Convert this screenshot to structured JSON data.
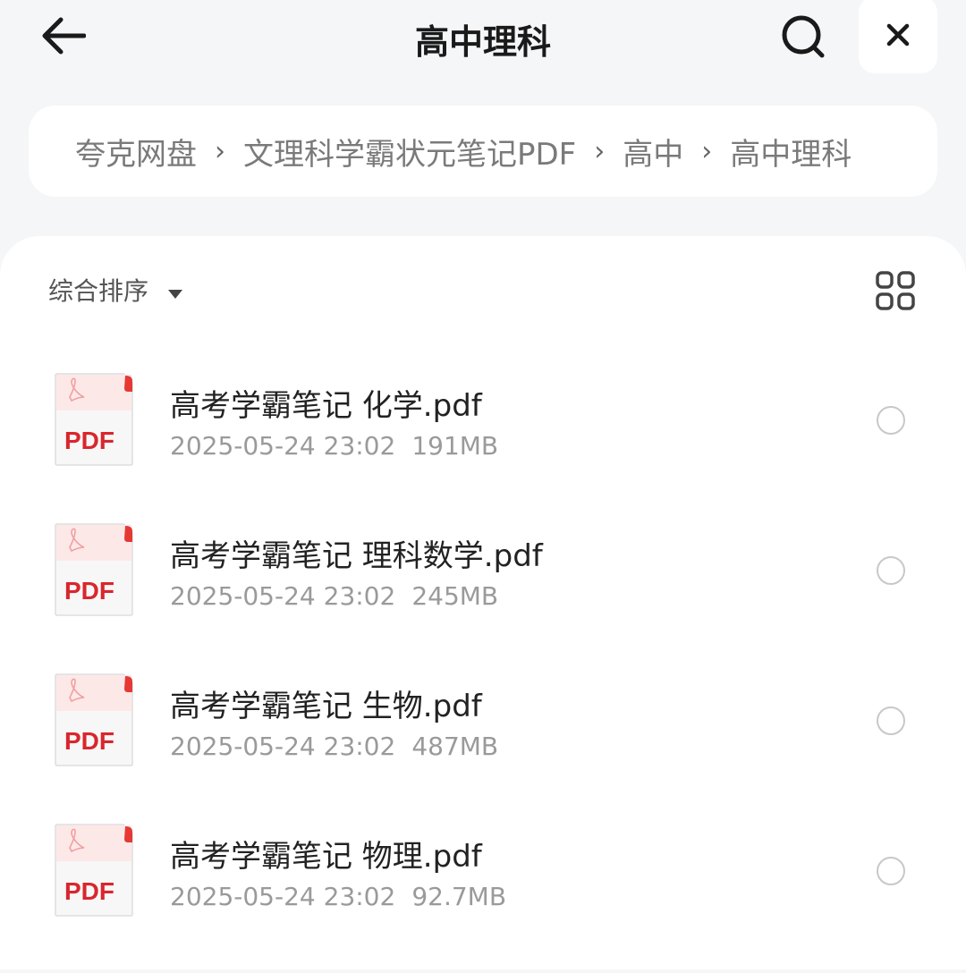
{
  "header": {
    "title": "高中理科"
  },
  "breadcrumb": [
    "夸克网盘",
    "文理科学霸状元笔记PDF",
    "高中",
    "高中理科"
  ],
  "toolbar": {
    "sort_label": "综合排序"
  },
  "files": [
    {
      "name": "高考学霸笔记 化学.pdf",
      "date": "2025-05-24 23:02",
      "size": "191MB",
      "icon_label": "PDF"
    },
    {
      "name": "高考学霸笔记 理科数学.pdf",
      "date": "2025-05-24 23:02",
      "size": "245MB",
      "icon_label": "PDF"
    },
    {
      "name": "高考学霸笔记 生物.pdf",
      "date": "2025-05-24 23:02",
      "size": "487MB",
      "icon_label": "PDF"
    },
    {
      "name": "高考学霸笔记 物理.pdf",
      "date": "2025-05-24 23:02",
      "size": "92.7MB",
      "icon_label": "PDF"
    }
  ],
  "colors": {
    "pdf_red": "#d9262d",
    "background": "#f5f6f8"
  }
}
